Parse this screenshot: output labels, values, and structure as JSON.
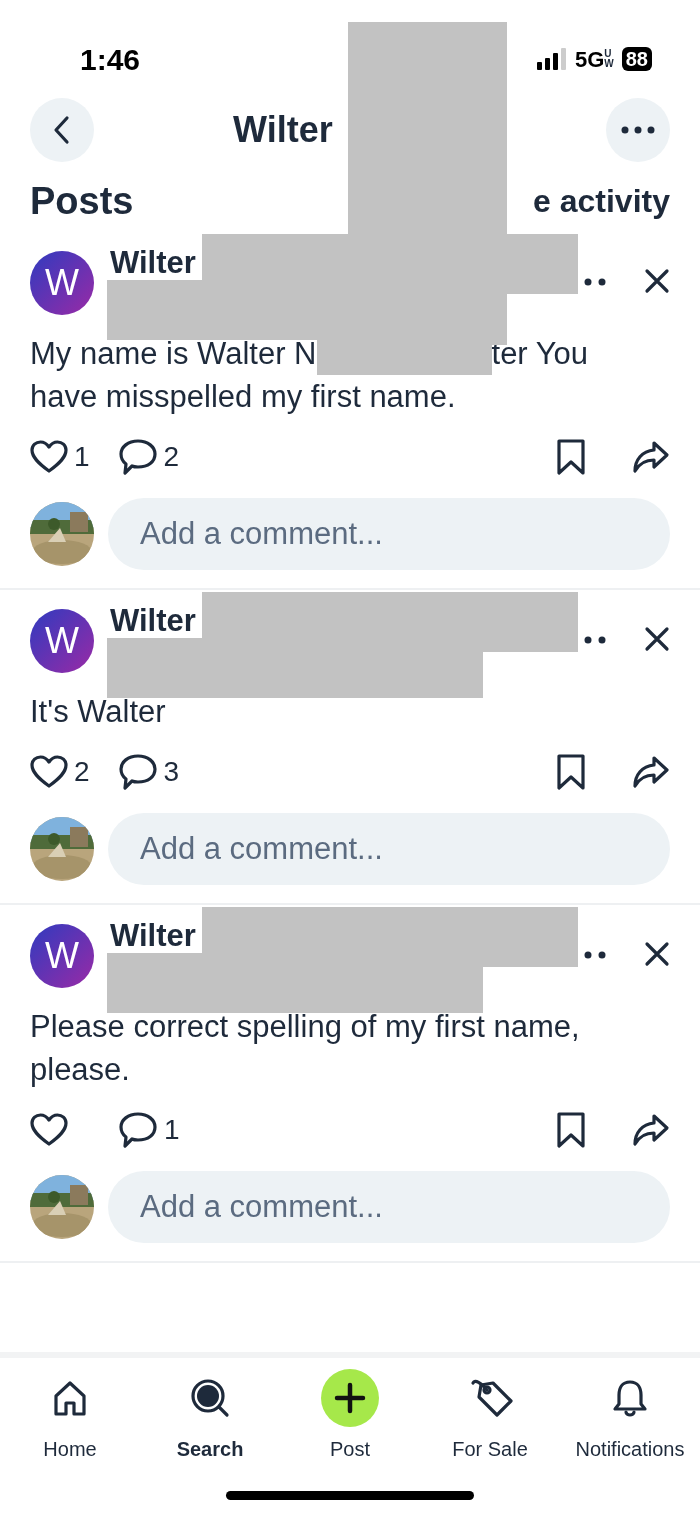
{
  "status_bar": {
    "time": "1:46",
    "network": "5G",
    "network_sup": "U",
    "network_sub": "W",
    "battery": "88"
  },
  "header": {
    "title": "Wilter"
  },
  "section": {
    "title": "Posts",
    "link": "e activity"
  },
  "posts": [
    {
      "author": "Wilter",
      "initial": "W",
      "text_lines": [
        [
          "My name is Walter N",
          "ter You"
        ],
        [
          "have misspelled my first name."
        ]
      ],
      "likes": "1",
      "comments": "2",
      "comment_placeholder": "Add a comment..."
    },
    {
      "author": "Wilter",
      "initial": "W",
      "text_lines": [
        [
          "It's Walter"
        ]
      ],
      "likes": "2",
      "comments": "3",
      "comment_placeholder": "Add a comment..."
    },
    {
      "author": "Wilter",
      "initial": "W",
      "text_lines": [
        [
          "Please correct spelling of my first name, please."
        ]
      ],
      "comments": "1",
      "comment_placeholder": "Add a comment..."
    }
  ],
  "tabs": [
    {
      "kind": "home",
      "label": "Home",
      "selected": false
    },
    {
      "kind": "search",
      "label": "Search",
      "selected": true
    },
    {
      "kind": "post",
      "label": "Post",
      "selected": false
    },
    {
      "kind": "sale",
      "label": "For Sale",
      "selected": false
    },
    {
      "kind": "bell",
      "label": "Notifications",
      "selected": false
    }
  ]
}
